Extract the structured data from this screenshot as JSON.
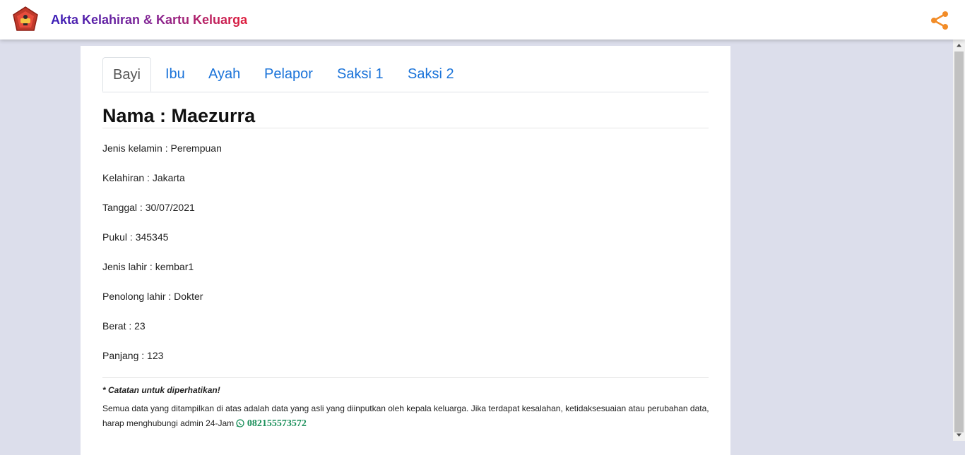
{
  "header": {
    "title": "Akta Kelahiran & Kartu Keluarga",
    "logo_icon": "emblem-logo-icon",
    "share_icon": "share-icon",
    "share_color": "#f28c28"
  },
  "tabs": [
    {
      "label": "Bayi",
      "active": true
    },
    {
      "label": "Ibu",
      "active": false
    },
    {
      "label": "Ayah",
      "active": false
    },
    {
      "label": "Pelapor",
      "active": false
    },
    {
      "label": "Saksi 1",
      "active": false
    },
    {
      "label": "Saksi 2",
      "active": false
    }
  ],
  "detail": {
    "heading": "Nama : Maezurra",
    "fields": [
      "Jenis kelamin : Perempuan",
      "Kelahiran : Jakarta",
      "Tanggal : 30/07/2021",
      "Pukul : 345345",
      "Jenis lahir : kembar1",
      "Penolong lahir : Dokter",
      "Berat : 23",
      "Panjang : 123"
    ]
  },
  "note": {
    "title": "* Catatan untuk diperhatikan!",
    "text": "Semua data yang ditampilkan di atas adalah data yang asli yang diinputkan oleh kepala keluarga. Jika terdapat kesalahan, ketidaksesuaian atau perubahan data, harap menghubungi admin 24-Jam",
    "phone": "082155573572",
    "phone_icon": "whatsapp-icon",
    "phone_color": "#1a8f5a"
  },
  "colors": {
    "tab_link": "#1a73d9",
    "background": "#dcdeeb"
  }
}
